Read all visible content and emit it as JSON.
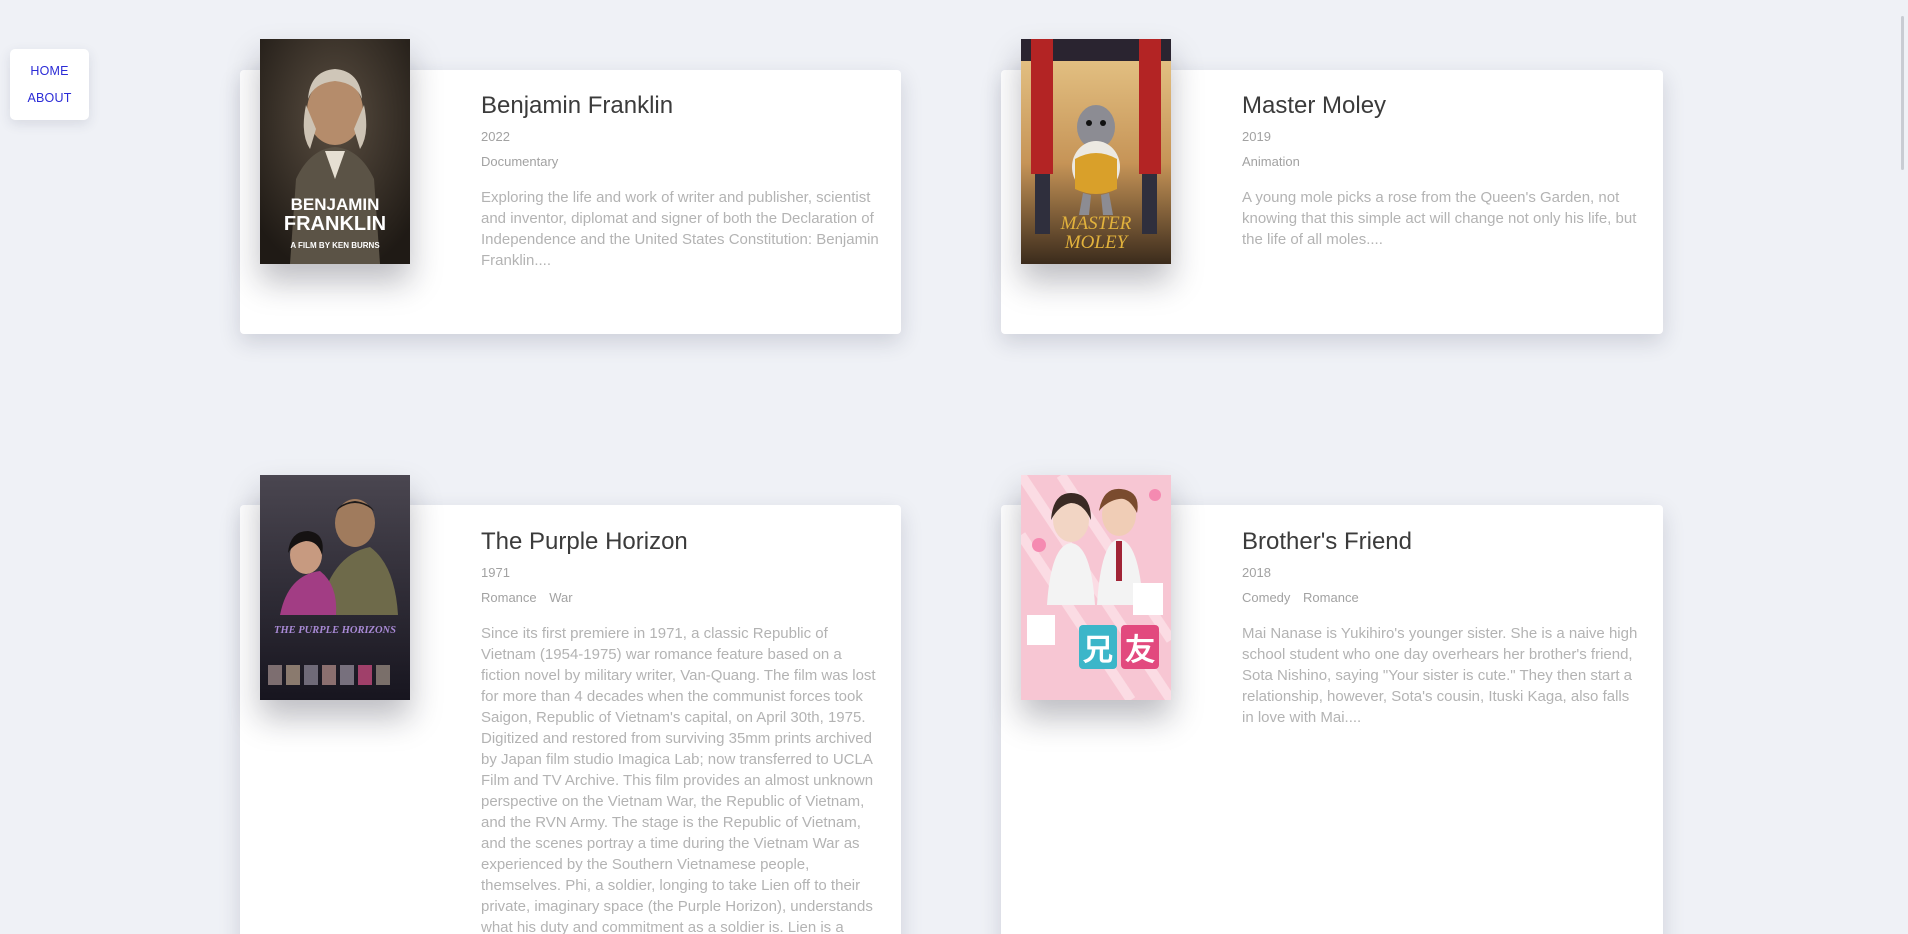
{
  "nav": {
    "home_label": "HOME",
    "about_label": "ABOUT"
  },
  "movies": [
    {
      "title": "Benjamin Franklin",
      "year": "2022",
      "genres": [
        "Documentary"
      ],
      "description": "Exploring the life and work of writer and publisher, scientist and inventor, diplomat and signer of both the Declaration of Independence and the United States Constitution: Benjamin Franklin....",
      "poster": {
        "line1": "BENJAMIN",
        "line2": "FRANKLIN",
        "line3": "A FILM BY KEN BURNS"
      }
    },
    {
      "title": "Master Moley",
      "year": "2019",
      "genres": [
        "Animation"
      ],
      "description": "A young mole picks a rose from the Queen's Garden, not knowing that this simple act will change not only his life, but the life of all moles....",
      "poster": {
        "line1": "MASTER",
        "line2": "MOLEY"
      }
    },
    {
      "title": "The Purple Horizon",
      "year": "1971",
      "genres": [
        "Romance",
        "War"
      ],
      "description": "Since its first premiere in 1971, a classic Republic of Vietnam (1954-1975) war romance feature based on a fiction novel by military writer, Van-Quang. The film was lost for more than 4 decades when the communist forces took Saigon, Republic of Vietnam's capital, on April 30th, 1975. Digitized and restored from surviving 35mm prints archived by Japan film studio Imagica Lab; now transferred to UCLA Film and TV Archive. This film provides an almost unknown perspective on the Vietnam War, the Republic of Vietnam, and the RVN Army. The stage is the Republic of Vietnam, and the scenes portray a time during the Vietnam War as experienced by the Southern Vietnamese people, themselves. Phi, a soldier, longing to take Lien off to their private, imaginary space (the Purple Horizon), understands what his duty and commitment as a soldier is. Lien is a",
      "poster": {
        "line1": "THE PURPLE HORIZONS"
      }
    },
    {
      "title": "Brother's Friend",
      "year": "2018",
      "genres": [
        "Comedy",
        "Romance"
      ],
      "description": "Mai Nanase is Yukihiro's younger sister. She is a naive high school student who one day overhears her brother's friend, Sota Nishino, saying \"Your sister is cute.\" They then start a relationship, however, Sota's cousin, Ituski Kaga, also falls in love with Mai....",
      "poster": {
        "line1": "兄",
        "line2": "友"
      }
    }
  ],
  "colors": {
    "background": "#eff1f6",
    "nav_link": "#2b2bd6",
    "title": "#3b3b3b",
    "meta": "#a2a2a2",
    "description": "#b3b3b3"
  }
}
